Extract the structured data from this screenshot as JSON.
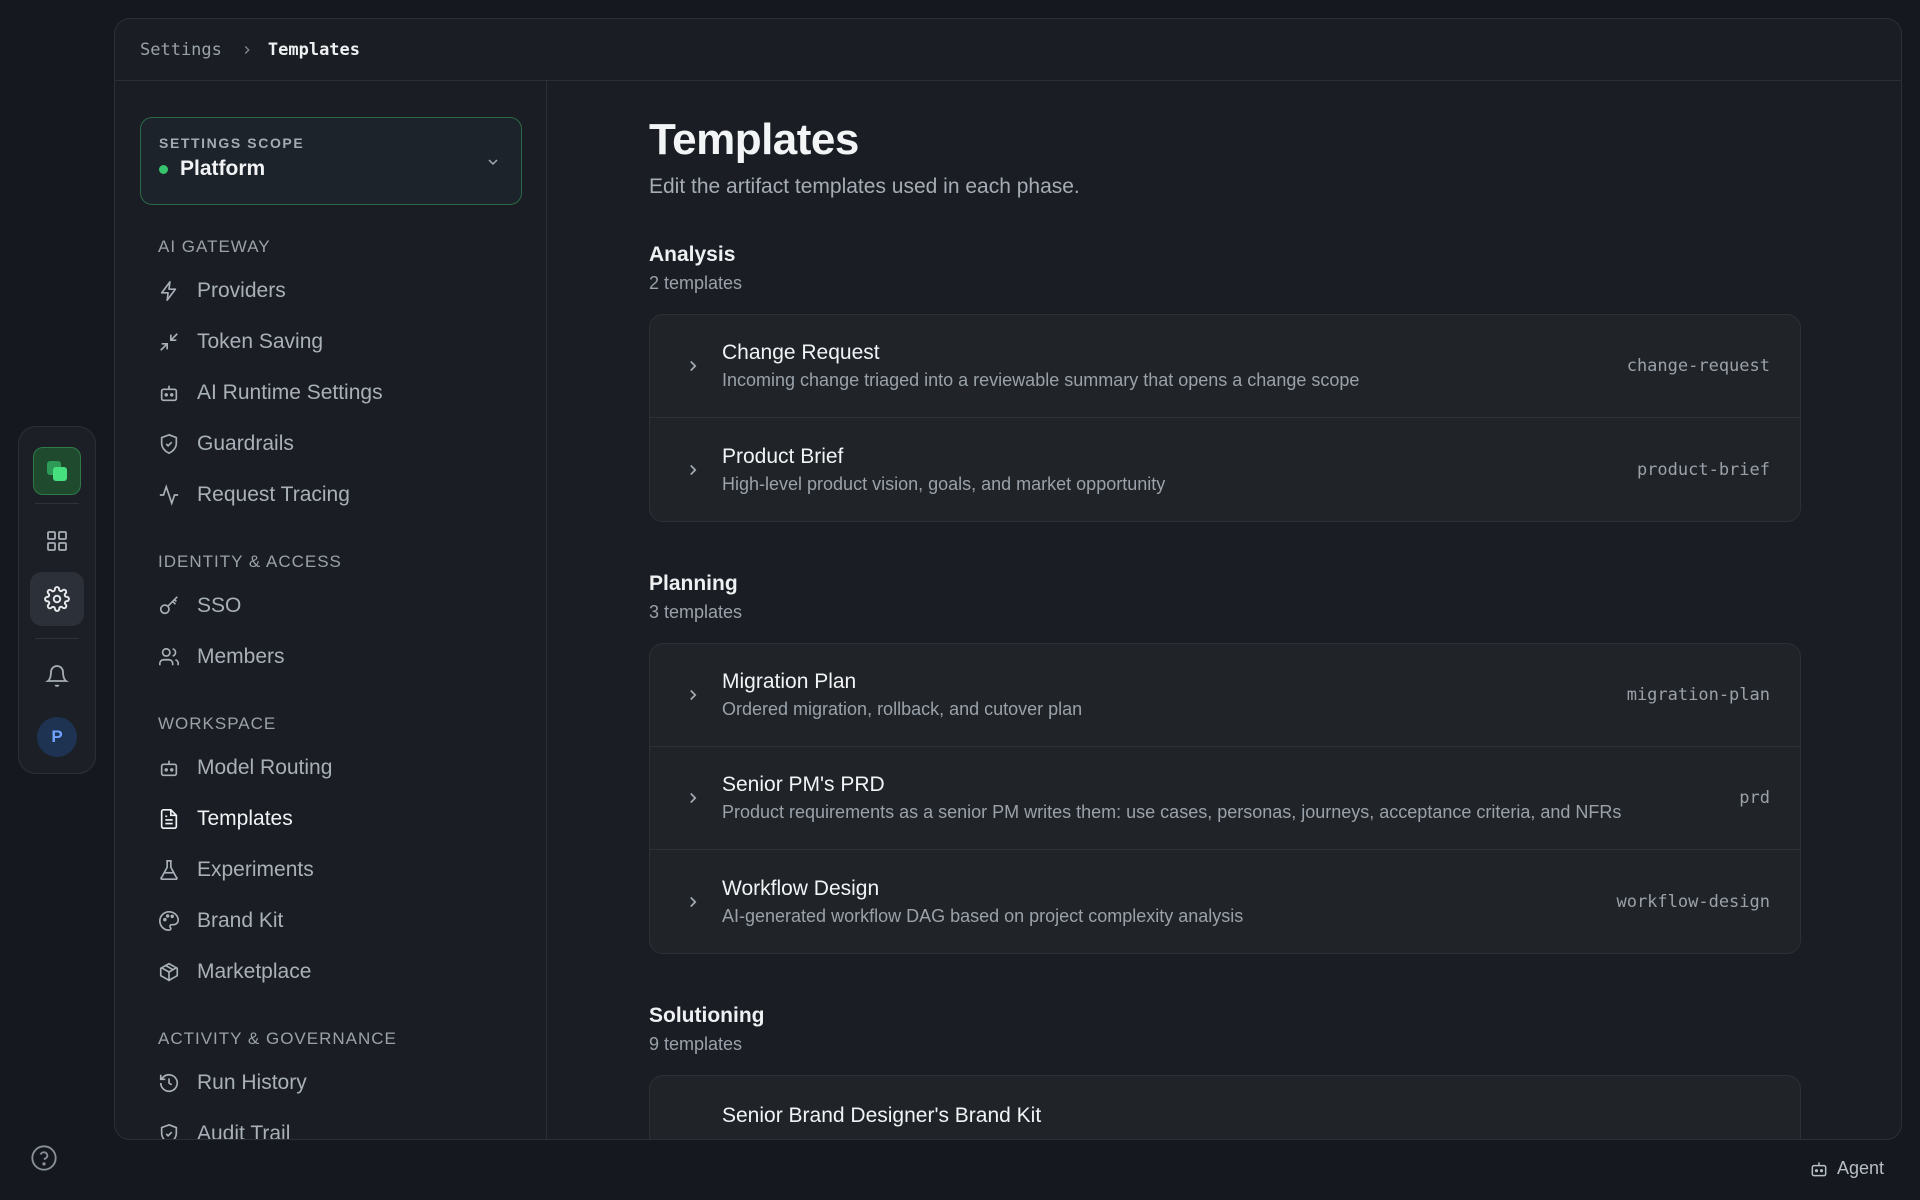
{
  "breadcrumb": {
    "parent": "Settings",
    "current": "Templates"
  },
  "rail": {
    "avatar_initial": "P"
  },
  "agent_button": {
    "label": "Agent"
  },
  "scope": {
    "label": "SETTINGS SCOPE",
    "value": "Platform"
  },
  "nav": {
    "sections": [
      {
        "heading": "AI GATEWAY",
        "items": [
          {
            "label": "Providers",
            "icon": "lightning-icon"
          },
          {
            "label": "Token Saving",
            "icon": "compress-arrows-icon"
          },
          {
            "label": "AI Runtime Settings",
            "icon": "bot-icon"
          },
          {
            "label": "Guardrails",
            "icon": "shield-check-icon"
          },
          {
            "label": "Request Tracing",
            "icon": "activity-icon"
          }
        ]
      },
      {
        "heading": "IDENTITY & ACCESS",
        "items": [
          {
            "label": "SSO",
            "icon": "key-icon"
          },
          {
            "label": "Members",
            "icon": "users-icon"
          }
        ]
      },
      {
        "heading": "WORKSPACE",
        "items": [
          {
            "label": "Model Routing",
            "icon": "bot-icon"
          },
          {
            "label": "Templates",
            "icon": "file-text-icon",
            "active": true
          },
          {
            "label": "Experiments",
            "icon": "flask-icon"
          },
          {
            "label": "Brand Kit",
            "icon": "palette-icon"
          },
          {
            "label": "Marketplace",
            "icon": "package-icon"
          }
        ]
      },
      {
        "heading": "ACTIVITY & GOVERNANCE",
        "items": [
          {
            "label": "Run History",
            "icon": "history-icon"
          },
          {
            "label": "Audit Trail",
            "icon": "shield-check-icon"
          }
        ]
      }
    ]
  },
  "page": {
    "title": "Templates",
    "subtitle": "Edit the artifact templates used in each phase."
  },
  "groups": [
    {
      "title": "Analysis",
      "count": "2 templates",
      "templates": [
        {
          "name": "Change Request",
          "desc": "Incoming change triaged into a reviewable summary that opens a change scope",
          "slug": "change-request"
        },
        {
          "name": "Product Brief",
          "desc": "High-level product vision, goals, and market opportunity",
          "slug": "product-brief"
        }
      ]
    },
    {
      "title": "Planning",
      "count": "3 templates",
      "templates": [
        {
          "name": "Migration Plan",
          "desc": "Ordered migration, rollback, and cutover plan",
          "slug": "migration-plan"
        },
        {
          "name": "Senior PM's PRD",
          "desc": "Product requirements as a senior PM writes them: use cases, personas, journeys, acceptance criteria, and NFRs",
          "slug": "prd"
        },
        {
          "name": "Workflow Design",
          "desc": "AI-generated workflow DAG based on project complexity analysis",
          "slug": "workflow-design"
        }
      ]
    },
    {
      "title": "Solutioning",
      "count": "9 templates",
      "templates": [
        {
          "name": "Senior Brand Designer's Brand Kit",
          "desc": "",
          "slug": ""
        }
      ]
    }
  ],
  "colors": {
    "accent": "#35c46b",
    "background": "#15191f",
    "panel": "#1a1e24"
  }
}
